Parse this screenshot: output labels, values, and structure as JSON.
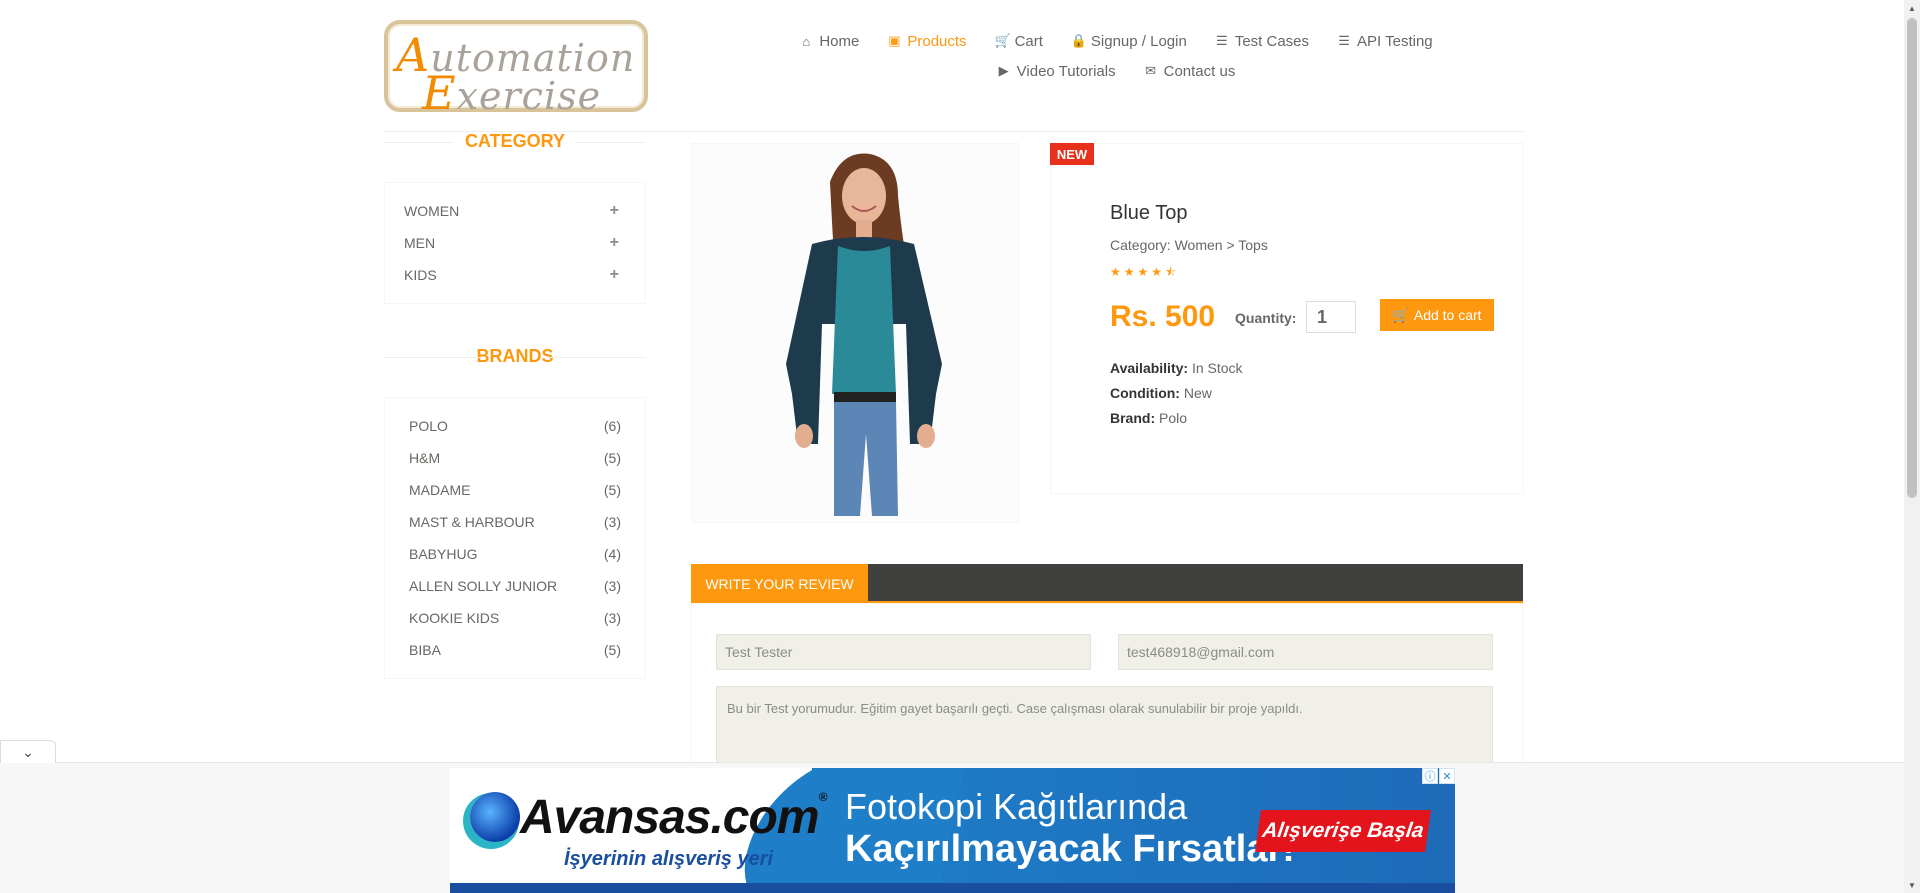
{
  "logo": {
    "line1_cap": "A",
    "line1_rest": "utomation",
    "line2_cap": "E",
    "line2_rest": "xercise"
  },
  "nav": {
    "row1": [
      {
        "label": "Home",
        "icon": "home-icon",
        "glyph": "⌂",
        "active": false
      },
      {
        "label": "Products",
        "icon": "products-icon",
        "glyph": "▣",
        "active": true
      },
      {
        "label": "Cart",
        "icon": "cart-icon",
        "glyph": "🛒",
        "active": false
      },
      {
        "label": "Signup / Login",
        "icon": "lock-icon",
        "glyph": "🔒",
        "active": false
      },
      {
        "label": "Test Cases",
        "icon": "list-icon",
        "glyph": "☰",
        "active": false
      },
      {
        "label": "API Testing",
        "icon": "list-icon",
        "glyph": "☰",
        "active": false
      }
    ],
    "row2": [
      {
        "label": "Video Tutorials",
        "icon": "video-icon",
        "glyph": "▶",
        "active": false
      },
      {
        "label": "Contact us",
        "icon": "envelope-icon",
        "glyph": "✉",
        "active": false
      }
    ]
  },
  "sidebar": {
    "category_title": "CATEGORY",
    "categories": [
      "WOMEN",
      "MEN",
      "KIDS"
    ],
    "brands_title": "BRANDS",
    "brands": [
      {
        "name": "POLO",
        "count": "(6)"
      },
      {
        "name": "H&M",
        "count": "(5)"
      },
      {
        "name": "MADAME",
        "count": "(5)"
      },
      {
        "name": "MAST & HARBOUR",
        "count": "(3)"
      },
      {
        "name": "BABYHUG",
        "count": "(4)"
      },
      {
        "name": "ALLEN SOLLY JUNIOR",
        "count": "(3)"
      },
      {
        "name": "KOOKIE KIDS",
        "count": "(3)"
      },
      {
        "name": "BIBA",
        "count": "(5)"
      }
    ]
  },
  "product": {
    "badge": "NEW",
    "name": "Blue Top",
    "category": "Category: Women > Tops",
    "rating": 4.5,
    "price": "Rs. 500",
    "quantity_label": "Quantity:",
    "quantity": "1",
    "add_to_cart": "Add to cart",
    "availability_label": "Availability:",
    "availability": "In Stock",
    "condition_label": "Condition:",
    "condition": "New",
    "brand_label": "Brand:",
    "brand": "Polo"
  },
  "review": {
    "tab_label": "WRITE YOUR REVIEW",
    "name_value": "Test Tester",
    "email_value": "test468918@gmail.com",
    "review_value": "Bu bir Test yorumudur. Eğitim gayet başarılı geçti. Case çalışması olarak sunulabilir bir proje yapıldı."
  },
  "ad": {
    "brand": "Avansas.com",
    "registered": "®",
    "tagline": "İşyerinin alışveriş yeri",
    "headline1": "Fotokopi Kağıtlarında",
    "headline2": "Kaçırılmayacak Fırsatlar!",
    "cta": "Alışverişe Başla",
    "accent": "#1e7ec8",
    "cta_color": "#e3141c"
  },
  "colors": {
    "accent": "#fe980f",
    "badge": "#e8311a",
    "dark_bar": "#40403e"
  }
}
